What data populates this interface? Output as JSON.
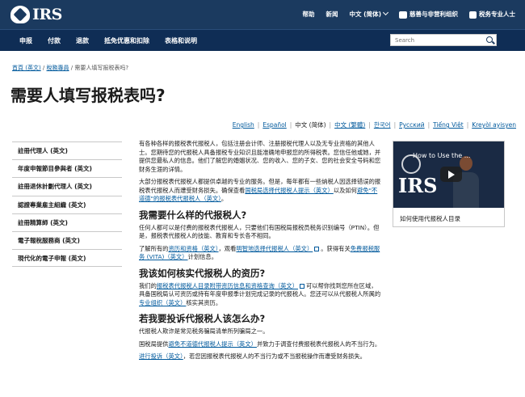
{
  "header": {
    "logo_text": "IRS",
    "links": [
      "帮助",
      "新闻",
      "中文 (简体)",
      "慈善与非营利组织",
      "税务专业人士"
    ]
  },
  "nav": {
    "items": [
      "申报",
      "付款",
      "退款",
      "抵免优惠和扣除",
      "表格和说明"
    ],
    "search_placeholder": "Search"
  },
  "breadcrumb": {
    "home": "首頁 (英文)",
    "section": "稅務專員",
    "current": "需要人填写报税表吗?"
  },
  "page_title": "需要人填写报税表吗?",
  "languages": [
    {
      "label": "English",
      "link": true
    },
    {
      "label": "Español",
      "link": true
    },
    {
      "label": "中文 (简体)",
      "link": false
    },
    {
      "label": "中文 (繁體)",
      "link": true
    },
    {
      "label": "한국어",
      "link": true
    },
    {
      "label": "Русский",
      "link": true
    },
    {
      "label": "Tiếng Việt",
      "link": true
    },
    {
      "label": "Kreyòl ayisyen",
      "link": true
    }
  ],
  "sidebar": {
    "items": [
      "註冊代理人 (英文)",
      "年度申報節目參與者 (英文)",
      "註冊退休計劃代理人 (英文)",
      "認證專業雇主組織 (英文)",
      "註冊精算師 (英文)",
      "電子報稅服務商 (英文)",
      "現代化的電子申報 (英文)"
    ]
  },
  "content": {
    "p1": "有各种各样的报税表代报税人，包括注册会计师、注册报税代理人以及无专业资格的其他人士。您期待您的代报税人具备报税专业知识且能准确地申报您的所得税表。您信任他或她，并提供您最私人的信息。他们了解您的婚姻状况、您的收入、您的子女、您的社会安全号码和您财务生涯的详情。",
    "p2_a": "大部分报税表代报税人都提供卓越的专业的服务。但是，每年都有一些纳税人因选择错误的报税表代报税人而遭受财务损失。确保查看",
    "p2_link1": "国税局选择代报税人提示（英文）",
    "p2_b": "以及如何",
    "p2_link2": "避免\"不道德\"的报税表代报税人（英文）",
    "p2_c": "。",
    "h1": "我需要什么样的代报税人?",
    "p3": "任何人都可以是付费的报税表代报税人，只要他们有国税局报税员税务识别编号（PTIN）。但是，报税表代报税人的技能、教育和专长各不相同。",
    "p4_a": "了解所有的",
    "p4_link1": "资历和资格（英文）",
    "p4_b": "，观看",
    "p4_link2": "明智地选择代报税人（英文）",
    "p4_c": "。获得有关",
    "p4_link3": "免费报税服务 (VITA)（英文）",
    "p4_d": "计划信息。",
    "h2": "我该如何核实代报税人的资历?",
    "p5_a": "我们的",
    "p5_link1": "报税表代报税人目录附带资历信息和资格查询（英文）",
    "p5_b": "可以帮你找到您所在区域，具备国税局认可资历或持有年度申报季计划完成记录的代报税人。您还可以从代报税人所属的",
    "p5_link2": "专业组织（英文）",
    "p5_c": "核实其资历。",
    "h3": "若我要投诉代报税人该怎么办?",
    "p6": "代报税人欺诈是常见税务骗局清单所列骗局之一。",
    "p7_a": "国税局提供",
    "p7_link1": "避免不道德代报税人提示（英文）",
    "p7_b": "并致力于调查付费报税表代报税人的不当行为。",
    "p8_link1": "进行投诉（英文）",
    "p8_a": "，若您因报税表代报税人的不当行为或不当报税操作而遭受财务损失。"
  },
  "video": {
    "title": "How to Use the ...",
    "bg_text": "IRS",
    "caption": "如何使用代报税人目录"
  }
}
